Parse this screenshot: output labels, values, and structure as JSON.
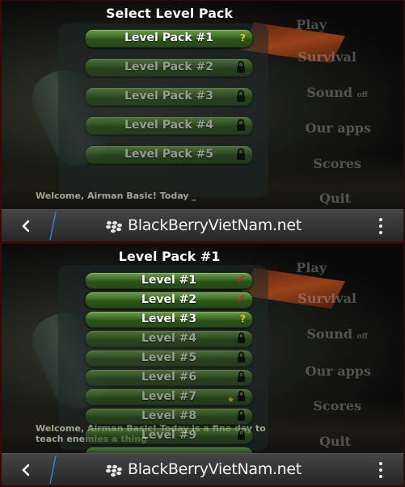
{
  "colors": {
    "button_green": "#3a6b22",
    "question_mark": "#f0c400",
    "checkmark": "#d02020",
    "star": "#f5d300",
    "frame": "#3a0808"
  },
  "top_screen": {
    "title": "Select Level Pack",
    "packs": [
      {
        "label": "Level Pack #1",
        "status": "?",
        "status_icon": "question-icon",
        "locked": false
      },
      {
        "label": "Level Pack #2",
        "status_icon": "lock-icon",
        "locked": true
      },
      {
        "label": "Level Pack #3",
        "status_icon": "lock-icon",
        "locked": true
      },
      {
        "label": "Level Pack #4",
        "status_icon": "lock-icon",
        "locked": true
      },
      {
        "label": "Level Pack #5",
        "status_icon": "lock-icon",
        "locked": true
      }
    ],
    "background_menu": {
      "play": "Play",
      "survival": "Survival",
      "sound": "Sound",
      "sound_state": "off",
      "our_apps": "Our apps",
      "scores": "Scores",
      "quit": "Quit"
    },
    "welcome_text": "Welcome, Airman Basic! Today _"
  },
  "bottom_screen": {
    "title": "Level Pack #1",
    "levels": [
      {
        "label": "Level #1",
        "status": "✔",
        "status_icon": "checkmark-icon",
        "locked": false
      },
      {
        "label": "Level #2",
        "status": "✔",
        "status_icon": "checkmark-icon",
        "locked": false
      },
      {
        "label": "Level #3",
        "status": "?",
        "status_icon": "question-icon",
        "locked": false
      },
      {
        "label": "Level #4",
        "status_icon": "lock-icon",
        "locked": true
      },
      {
        "label": "Level #5",
        "status_icon": "lock-icon",
        "locked": true
      },
      {
        "label": "Level #6",
        "status_icon": "lock-icon",
        "locked": true
      },
      {
        "label": "Level #7",
        "status": "★",
        "status_icon": "star-lock-icon",
        "locked": true
      },
      {
        "label": "Level #8",
        "status_icon": "lock-icon",
        "locked": true
      },
      {
        "label": "Level #9",
        "status_icon": "lock-icon",
        "locked": true
      }
    ],
    "background_menu": {
      "play": "Play",
      "survival": "Survival",
      "sound": "Sound",
      "sound_state": "off",
      "our_apps": "Our apps",
      "scores": "Scores",
      "quit": "Quit"
    },
    "welcome_line1": "Welcome, Airman Basic! Today is a fine day to",
    "welcome_line2": "teach enemies a thing"
  },
  "navbar": {
    "back_icon": "chevron-left-icon",
    "brand_logo": "blackberry-logo-icon",
    "brand_text": "BlackBerryVietNam.net",
    "more_icon": "vertical-dots-icon"
  }
}
